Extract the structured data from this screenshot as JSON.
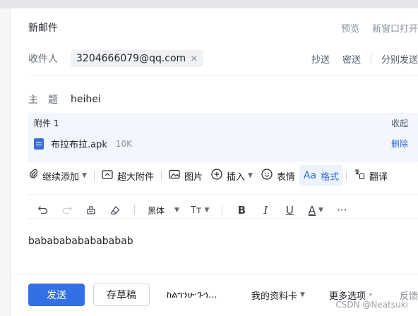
{
  "window": {
    "title": "新邮件",
    "preview": "预览",
    "new_window": "新窗口打开"
  },
  "recipients": {
    "label": "收件人",
    "chips": [
      "3204666079@qq.com"
    ],
    "remove_glyph": "×",
    "cc": "抄送",
    "bcc": "密送",
    "separate": "分别发送"
  },
  "subject": {
    "label": "主　题",
    "value": "heihei"
  },
  "attachments": {
    "header": "附件 1",
    "collapse": "收起",
    "files": [
      {
        "name": "布拉布拉.apk",
        "size": "10K",
        "delete": "删除"
      }
    ]
  },
  "toolbar": {
    "continue_add": "继续添加",
    "large_attach": "超大附件",
    "image": "图片",
    "insert": "插入",
    "emoji": "表情",
    "format": "格式",
    "format_icon_text": "Aa",
    "translate": "翻译"
  },
  "format_bar": {
    "font": "黑体",
    "font_size_icon": "Tт",
    "bold": "B",
    "italic": "I",
    "underline": "U",
    "color": "A",
    "more": "···"
  },
  "body": {
    "text": "babababababababab"
  },
  "footer": {
    "send": "发送",
    "draft": "存草稿",
    "ethiopic_option": "ከልግንሁ·ጉኅ...",
    "my_card": "我的资料卡",
    "more_options": "更多选项",
    "feedback": "反馈"
  },
  "watermark": "CSDN @Neatsuki",
  "colors": {
    "accent": "#3370e6",
    "attach_bg": "#f2f6fd",
    "link": "#2f6bd6"
  }
}
